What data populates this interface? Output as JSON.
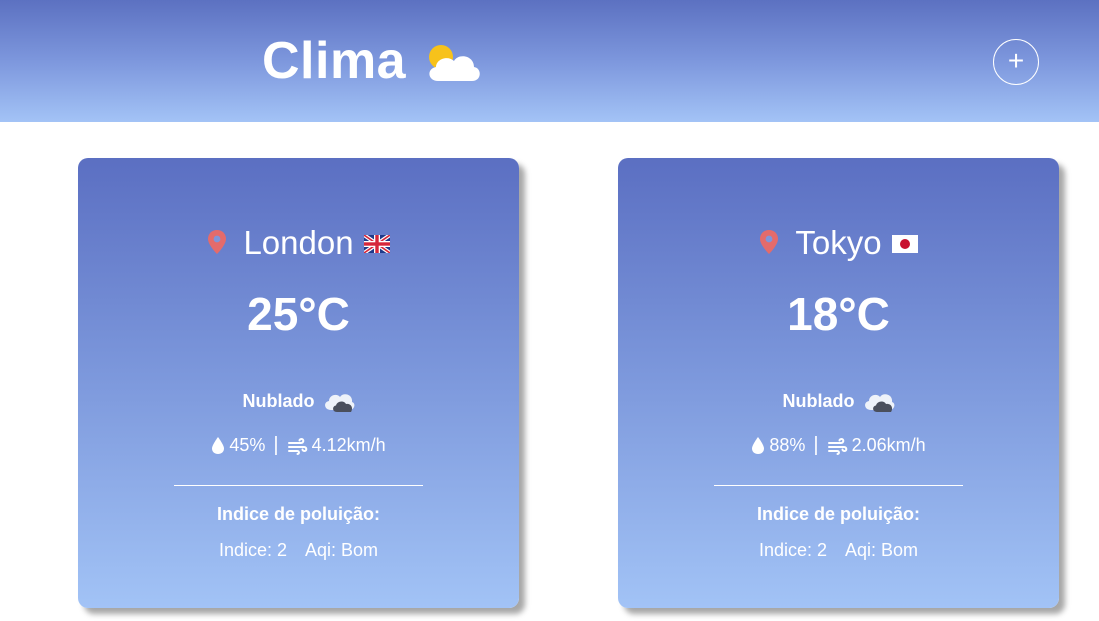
{
  "header": {
    "title": "Clima",
    "logo_icon": "partly-cloudy-icon",
    "add_button_label": "+",
    "gradient_top": "#5c71c1",
    "gradient_bottom": "#a3c3f6"
  },
  "cards": [
    {
      "city": "London",
      "flag": "uk-flag-icon",
      "temperature": "25°C",
      "condition": "Nublado",
      "condition_icon": "cloudy-icon",
      "humidity": "45%",
      "wind": "4.12km/h",
      "separator": "|",
      "pollution_title": "Indice de poluição:",
      "pollution_index": "Indice: 2",
      "aqi": "Aqi: Bom"
    },
    {
      "city": "Tokyo",
      "flag": "japan-flag-icon",
      "temperature": "18°C",
      "condition": "Nublado",
      "condition_icon": "cloudy-icon",
      "humidity": "88%",
      "wind": "2.06km/h",
      "separator": "|",
      "pollution_title": "Indice de poluição:",
      "pollution_index": "Indice: 2",
      "aqi": "Aqi: Bom"
    }
  ],
  "colors": {
    "pin": "#e46b6b",
    "card_top": "#5b6fc2",
    "card_bottom": "#a2c3f6"
  }
}
